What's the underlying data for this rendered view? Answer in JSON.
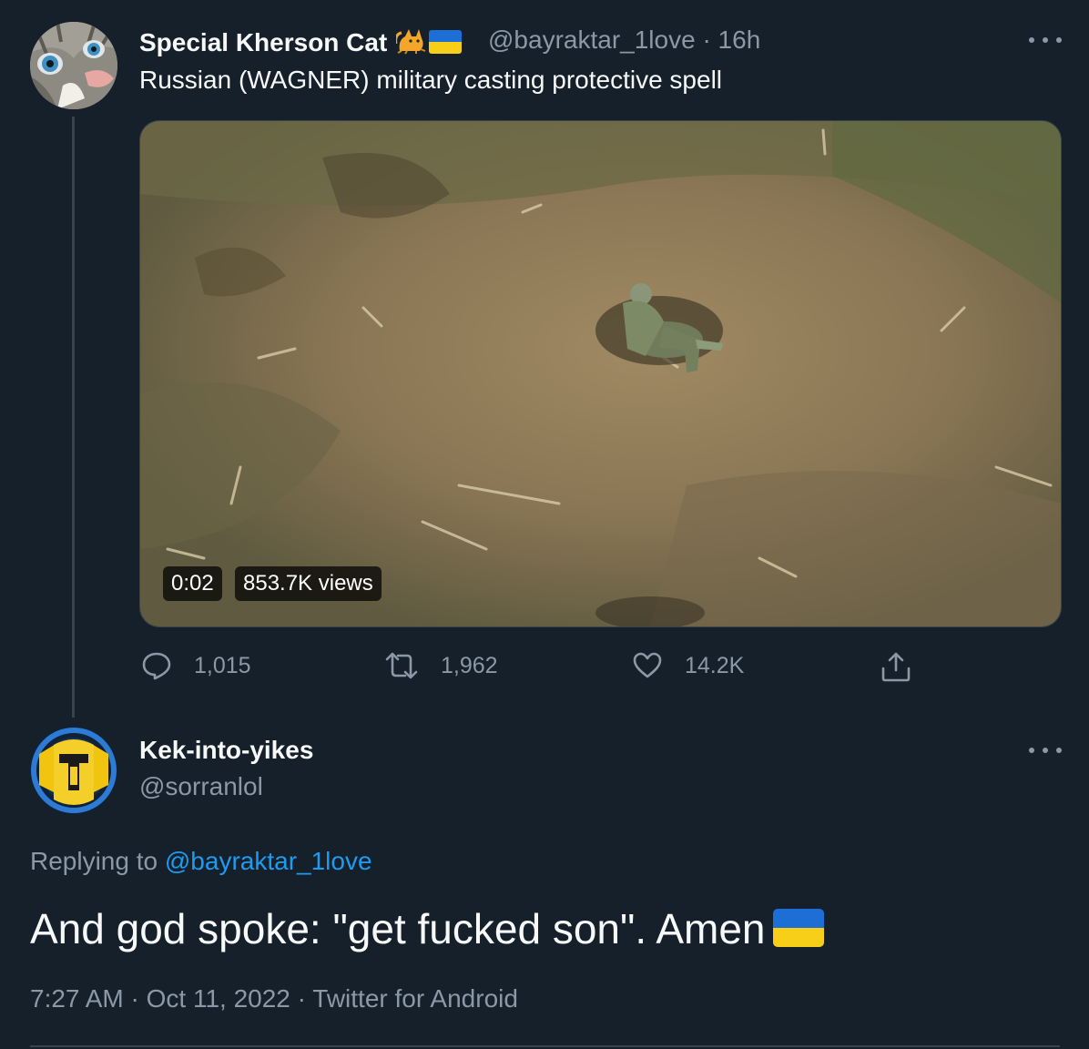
{
  "tweet": {
    "author_name": "Special Kherson Cat",
    "author_emoji": "cat-emoji",
    "author_flag": "ukraine-flag",
    "handle": "@bayraktar_1love",
    "separator": "·",
    "time_ago": "16h",
    "text": "Russian (WAGNER) military casting protective spell",
    "video": {
      "duration": "0:02",
      "views": "853.7K views"
    },
    "actions": {
      "replies": "1,015",
      "retweets": "1,962",
      "likes": "14.2K"
    }
  },
  "reply": {
    "author_name": "Kek-into-yikes",
    "handle": "@sorranlol",
    "replying_prefix": "Replying to",
    "replying_to": "@bayraktar_1love",
    "text": "And god spoke: \"get fucked son\". Amen",
    "text_flag": "ukraine-flag",
    "time": "7:27 AM",
    "date": "Oct 11, 2022",
    "source": "Twitter for Android",
    "separator": "·"
  },
  "colors": {
    "background": "#15202b",
    "text": "#f7f9f9",
    "muted": "#8b98a5",
    "link": "#1d9bf0",
    "border": "#38444d",
    "flag_blue": "#1d6fd6",
    "flag_yellow": "#f7cf19"
  }
}
